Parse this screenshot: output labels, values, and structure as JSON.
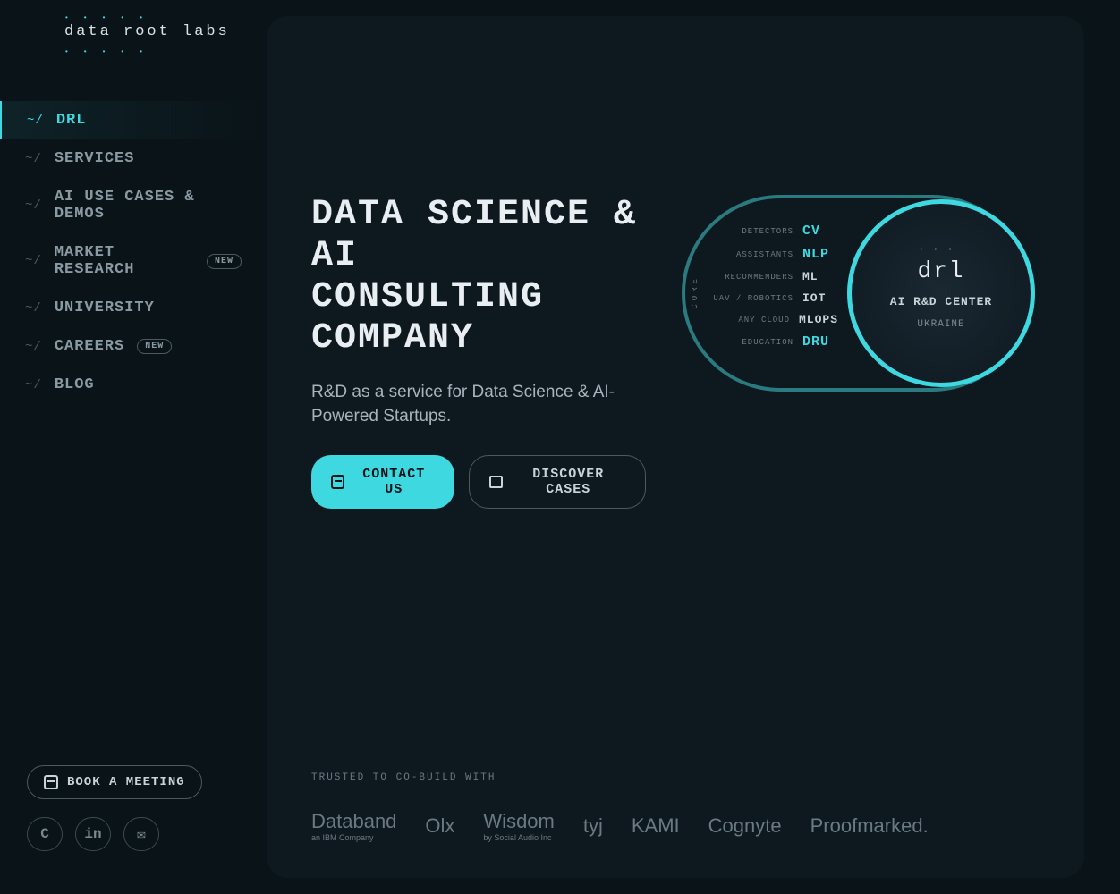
{
  "logo": "data root labs",
  "nav": [
    {
      "label": "DRL",
      "active": true
    },
    {
      "label": "SERVICES"
    },
    {
      "label": "AI USE CASES & DEMOS"
    },
    {
      "label": "MARKET RESEARCH",
      "badge": "NEW"
    },
    {
      "label": "UNIVERSITY"
    },
    {
      "label": "CAREERS",
      "badge": "NEW"
    },
    {
      "label": "BLOG"
    }
  ],
  "book_label": "BOOK A MEETING",
  "hero": {
    "title_line1": "DATA SCIENCE & AI",
    "title_line2": "CONSULTING COMPANY",
    "subtitle": "R&D as a service for Data Science & AI-Powered Startups.",
    "contact_btn": "CONTACT US",
    "discover_btn": "DISCOVER CASES"
  },
  "graphic": {
    "core": "CORE",
    "drl": "drl",
    "center_label": "AI R&D CENTER",
    "center_sub": "UKRAINE",
    "services": [
      {
        "label": "DETECTORS",
        "tag": "CV",
        "highlight": true
      },
      {
        "label": "ASSISTANTS",
        "tag": "NLP",
        "highlight": true
      },
      {
        "label": "RECOMMENDERS",
        "tag": "ML"
      },
      {
        "label": "UAV / ROBOTICS",
        "tag": "IOT"
      },
      {
        "label": "ANY CLOUD",
        "tag": "MLOPS"
      },
      {
        "label": "EDUCATION",
        "tag": "DRU",
        "highlight": true
      }
    ]
  },
  "trusted": {
    "label": "TRUSTED TO CO-BUILD WITH",
    "clients": [
      {
        "name": "Databand",
        "sub": "an IBM Company"
      },
      {
        "name": "Olx"
      },
      {
        "name": "Wisdom",
        "sub": "by Social Audio Inc"
      },
      {
        "name": "tyj"
      },
      {
        "name": "KAMI"
      },
      {
        "name": "Cognyte"
      },
      {
        "name": "Proofmarked."
      }
    ]
  }
}
